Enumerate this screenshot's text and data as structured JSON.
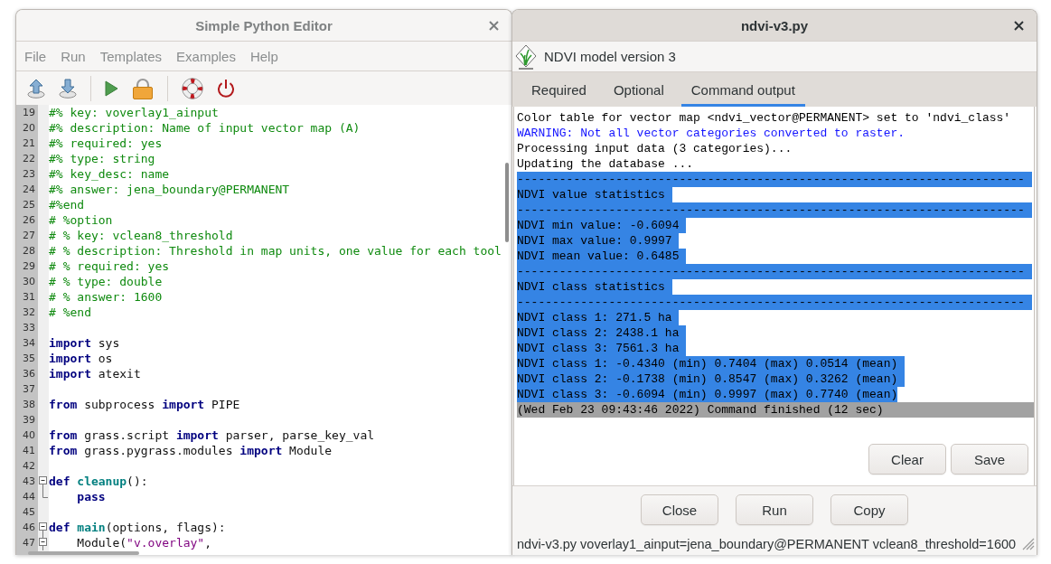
{
  "editor": {
    "title": "Simple Python Editor",
    "menu": [
      "File",
      "Run",
      "Templates",
      "Examples",
      "Help"
    ],
    "lines": [
      {
        "number": "19",
        "kind": "line",
        "tokens": [
          {
            "kind": "comment",
            "text": "#% key: voverlay1_ainput"
          }
        ]
      },
      {
        "number": "20",
        "kind": "line",
        "tokens": [
          {
            "kind": "comment",
            "text": "#% description: Name of input vector map (A)"
          }
        ]
      },
      {
        "number": "21",
        "kind": "line",
        "tokens": [
          {
            "kind": "comment",
            "text": "#% required: yes"
          }
        ]
      },
      {
        "number": "22",
        "kind": "line",
        "tokens": [
          {
            "kind": "comment",
            "text": "#% type: string"
          }
        ]
      },
      {
        "number": "23",
        "kind": "line",
        "tokens": [
          {
            "kind": "comment",
            "text": "#% key_desc: name"
          }
        ]
      },
      {
        "number": "24",
        "kind": "line",
        "tokens": [
          {
            "kind": "comment",
            "text": "#% answer: jena_boundary@PERMANENT"
          }
        ]
      },
      {
        "number": "25",
        "kind": "line",
        "tokens": [
          {
            "kind": "comment",
            "text": "#%end"
          }
        ]
      },
      {
        "number": "26",
        "kind": "line",
        "tokens": [
          {
            "kind": "comment",
            "text": "# %option"
          }
        ]
      },
      {
        "number": "27",
        "kind": "line",
        "tokens": [
          {
            "kind": "comment",
            "text": "# % key: vclean8_threshold"
          }
        ]
      },
      {
        "number": "28",
        "kind": "line",
        "tokens": [
          {
            "kind": "comment",
            "text": "# % description: Threshold in map units, one value for each tool"
          }
        ]
      },
      {
        "number": "29",
        "kind": "line",
        "tokens": [
          {
            "kind": "comment",
            "text": "# % required: yes"
          }
        ]
      },
      {
        "number": "30",
        "kind": "line",
        "tokens": [
          {
            "kind": "comment",
            "text": "# % type: double"
          }
        ]
      },
      {
        "number": "31",
        "kind": "line",
        "tokens": [
          {
            "kind": "comment",
            "text": "# % answer: 1600"
          }
        ]
      },
      {
        "number": "32",
        "kind": "line",
        "tokens": [
          {
            "kind": "comment",
            "text": "# %end"
          }
        ]
      },
      {
        "number": "33",
        "kind": "line"
      },
      {
        "number": "34",
        "kind": "line",
        "tokens": [
          {
            "kind": "keyword",
            "text": "import"
          },
          {
            "kind": "plain",
            "text": " sys"
          }
        ]
      },
      {
        "number": "35",
        "kind": "line",
        "tokens": [
          {
            "kind": "keyword",
            "text": "import"
          },
          {
            "kind": "plain",
            "text": " os"
          }
        ]
      },
      {
        "number": "36",
        "kind": "line",
        "tokens": [
          {
            "kind": "keyword",
            "text": "import"
          },
          {
            "kind": "plain",
            "text": " atexit"
          }
        ]
      },
      {
        "number": "37",
        "kind": "line"
      },
      {
        "number": "38",
        "kind": "line",
        "tokens": [
          {
            "kind": "keyword",
            "text": "from"
          },
          {
            "kind": "plain",
            "text": " subprocess "
          },
          {
            "kind": "keyword",
            "text": "import"
          },
          {
            "kind": "plain",
            "text": " PIPE"
          }
        ]
      },
      {
        "number": "39",
        "kind": "line"
      },
      {
        "number": "40",
        "kind": "line",
        "tokens": [
          {
            "kind": "keyword",
            "text": "from"
          },
          {
            "kind": "plain",
            "text": " grass.script "
          },
          {
            "kind": "keyword",
            "text": "import"
          },
          {
            "kind": "plain",
            "text": " parser, parse_key_val"
          }
        ]
      },
      {
        "number": "41",
        "kind": "line",
        "tokens": [
          {
            "kind": "keyword",
            "text": "from"
          },
          {
            "kind": "plain",
            "text": " grass.pygrass.modules "
          },
          {
            "kind": "keyword",
            "text": "import"
          },
          {
            "kind": "plain",
            "text": " Module"
          }
        ]
      },
      {
        "number": "42",
        "kind": "line"
      },
      {
        "number": "43",
        "kind": "fold",
        "tokens": [
          {
            "kind": "keyword",
            "text": "def"
          },
          {
            "kind": "name",
            "text": " cleanup"
          },
          {
            "kind": "plain",
            "text": "():"
          }
        ]
      },
      {
        "number": "44",
        "kind": "foldend",
        "tokens": [
          {
            "kind": "keyword",
            "text": "    pass"
          }
        ]
      },
      {
        "number": "45",
        "kind": "line"
      },
      {
        "number": "46",
        "kind": "fold",
        "tokens": [
          {
            "kind": "keyword",
            "text": "def"
          },
          {
            "kind": "name",
            "text": " main"
          },
          {
            "kind": "plain",
            "text": "(options, flags):"
          }
        ]
      },
      {
        "number": "47",
        "kind": "subfold",
        "tokens": [
          {
            "kind": "plain",
            "text": "    Module("
          },
          {
            "kind": "string",
            "text": "\"v.overlay\""
          },
          {
            "kind": "plain",
            "text": ","
          }
        ]
      }
    ]
  },
  "tool_window": {
    "title": "ndvi-v3.py",
    "heading": "NDVI model version 3",
    "tabs": [
      {
        "label": "Required",
        "selected": false
      },
      {
        "label": "Optional",
        "selected": false
      },
      {
        "label": "Command output",
        "selected": true
      }
    ],
    "output": [
      {
        "kind": "normal",
        "selected": false,
        "text": "Color table for vector map <ndvi_vector@PERMANENT> set to 'ndvi_class'"
      },
      {
        "kind": "warning",
        "selected": false,
        "text": "WARNING: Not all vector categories converted to raster."
      },
      {
        "kind": "normal",
        "selected": false,
        "text": "Processing input data (3 categories)..."
      },
      {
        "kind": "normal",
        "selected": false,
        "text": "Updating the database ..."
      },
      {
        "kind": "normal",
        "selected": true,
        "text": "------------------------------------------------------------------------"
      },
      {
        "kind": "normal",
        "selected": true,
        "text": "NDVI value statistics"
      },
      {
        "kind": "normal",
        "selected": true,
        "text": "------------------------------------------------------------------------"
      },
      {
        "kind": "normal",
        "selected": true,
        "text": "NDVI min value: -0.6094"
      },
      {
        "kind": "normal",
        "selected": true,
        "text": "NDVI max value: 0.9997"
      },
      {
        "kind": "normal",
        "selected": true,
        "text": "NDVI mean value: 0.6485"
      },
      {
        "kind": "normal",
        "selected": true,
        "text": "------------------------------------------------------------------------"
      },
      {
        "kind": "normal",
        "selected": true,
        "text": "NDVI class statistics"
      },
      {
        "kind": "normal",
        "selected": true,
        "text": "------------------------------------------------------------------------"
      },
      {
        "kind": "normal",
        "selected": true,
        "text": "NDVI class 1: 271.5 ha"
      },
      {
        "kind": "normal",
        "selected": true,
        "text": "NDVI class 2: 2438.1 ha"
      },
      {
        "kind": "normal",
        "selected": true,
        "text": "NDVI class 3: 7561.3 ha"
      },
      {
        "kind": "normal",
        "selected": true,
        "text": "NDVI class 1: -0.4340 (min) 0.7404 (max) 0.0514 (mean)"
      },
      {
        "kind": "normal",
        "selected": true,
        "text": "NDVI class 2: -0.1738 (min) 0.8547 (max) 0.3262 (mean)"
      },
      {
        "kind": "normal",
        "selected": true,
        "text": "NDVI class 3: -0.6094 (min) 0.9997 (max) 0.7740 (mean)"
      },
      {
        "kind": "finished",
        "selected": false,
        "text": "(Wed Feb 23 09:43:46 2022) Command finished (12 sec)"
      }
    ],
    "output_buttons": [
      "Clear",
      "Save"
    ],
    "buttons": [
      "Close",
      "Run",
      "Copy"
    ],
    "status": "ndvi-v3.py voverlay1_ainput=jena_boundary@PERMANENT vclean8_threshold=1600"
  }
}
